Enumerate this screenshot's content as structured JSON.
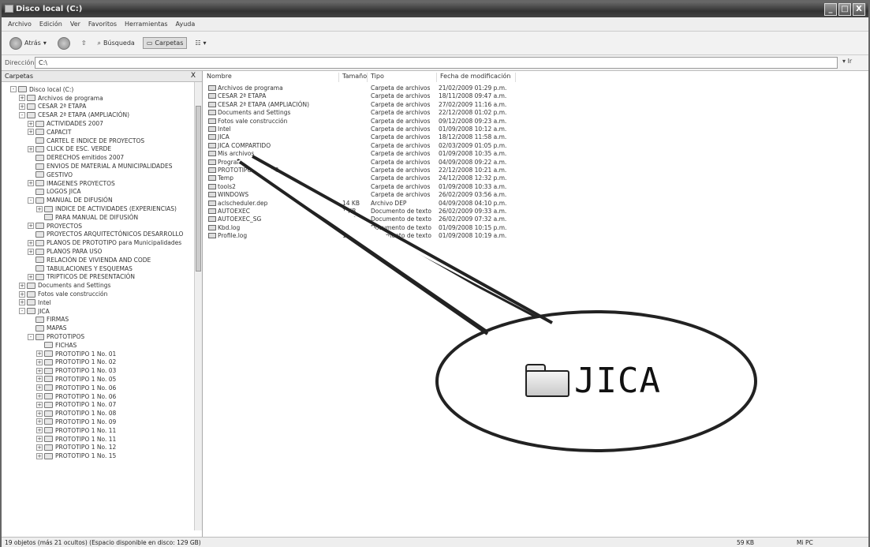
{
  "window": {
    "title": "Disco local (C:)"
  },
  "window_buttons": [
    "_",
    "□",
    "X"
  ],
  "menu": [
    "Archivo",
    "Edición",
    "Ver",
    "Favoritos",
    "Herramientas",
    "Ayuda"
  ],
  "toolbar": {
    "back": "Atrás",
    "search": "Búsqueda",
    "folders": "Carpetas"
  },
  "address": {
    "label": "Dirección",
    "value": "C:\\",
    "go": "Ir"
  },
  "left_pane": {
    "title": "Carpetas",
    "close": "X",
    "tree": [
      {
        "exp": "-",
        "label": "Disco local (C:)",
        "indent": 1
      },
      {
        "exp": "+",
        "label": "Archivos de programa",
        "indent": 2
      },
      {
        "exp": "+",
        "label": "CESAR 2ª ETAPA",
        "indent": 2
      },
      {
        "exp": "-",
        "label": "CESAR 2ª ETAPA (AMPLIACIÓN)",
        "indent": 2
      },
      {
        "exp": "+",
        "label": "ACTIVIDADES 2007",
        "indent": 3
      },
      {
        "exp": "+",
        "label": "CAPACIT",
        "indent": 3
      },
      {
        "exp": "",
        "label": "CARTEL E INDICE DE PROYECTOS",
        "indent": 3
      },
      {
        "exp": "+",
        "label": "CLICK DE ESC. VERDE",
        "indent": 3
      },
      {
        "exp": "",
        "label": "DERECHOS emitidos 2007",
        "indent": 3
      },
      {
        "exp": "",
        "label": "ENVIOS DE MATERIAL A MUNICIPALIDADES",
        "indent": 3
      },
      {
        "exp": "",
        "label": "GESTIVO",
        "indent": 3
      },
      {
        "exp": "+",
        "label": "IMAGENES PROYECTOS",
        "indent": 3
      },
      {
        "exp": "",
        "label": "LOGOS JICA",
        "indent": 3
      },
      {
        "exp": "-",
        "label": "MANUAL DE DIFUSIÓN",
        "indent": 3
      },
      {
        "exp": "+",
        "label": "INDICE DE ACTIVIDADES (EXPERIENCIAS)",
        "indent": 4
      },
      {
        "exp": "",
        "label": "PARA MANUAL DE DIFUSIÓN",
        "indent": 4
      },
      {
        "exp": "+",
        "label": "PROYECTOS",
        "indent": 3
      },
      {
        "exp": "",
        "label": "PROYECTOS ARQUITECTÓNICOS DESARROLLO",
        "indent": 3
      },
      {
        "exp": "+",
        "label": "PLANOS DE PROTOTIPO para Municipalidades",
        "indent": 3
      },
      {
        "exp": "+",
        "label": "PLANOS PARA USO",
        "indent": 3
      },
      {
        "exp": "",
        "label": "RELACIÓN DE VIVIENDA AND CODE",
        "indent": 3
      },
      {
        "exp": "",
        "label": "TABULACIONES Y ESQUEMAS",
        "indent": 3
      },
      {
        "exp": "+",
        "label": "TRIPTICOS DE PRESENTACIÓN",
        "indent": 3
      },
      {
        "exp": "+",
        "label": "Documents and Settings",
        "indent": 2
      },
      {
        "exp": "+",
        "label": "Fotos vale construcción",
        "indent": 2
      },
      {
        "exp": "+",
        "label": "Intel",
        "indent": 2
      },
      {
        "exp": "-",
        "label": "JICA",
        "indent": 2
      },
      {
        "exp": "",
        "label": "FIRMAS",
        "indent": 3
      },
      {
        "exp": "",
        "label": "MAPAS",
        "indent": 3
      },
      {
        "exp": "-",
        "label": "PROTOTIPOS",
        "indent": 3
      },
      {
        "exp": "",
        "label": "FICHAS",
        "indent": 4
      },
      {
        "exp": "+",
        "label": "PROTOTIPO 1 No. 01",
        "indent": 4
      },
      {
        "exp": "+",
        "label": "PROTOTIPO 1 No. 02",
        "indent": 4
      },
      {
        "exp": "+",
        "label": "PROTOTIPO 1 No. 03",
        "indent": 4
      },
      {
        "exp": "+",
        "label": "PROTOTIPO 1 No. 05",
        "indent": 4
      },
      {
        "exp": "+",
        "label": "PROTOTIPO 1 No. 06",
        "indent": 4
      },
      {
        "exp": "+",
        "label": "PROTOTIPO 1 No. 06",
        "indent": 4
      },
      {
        "exp": "+",
        "label": "PROTOTIPO 1 No. 07",
        "indent": 4
      },
      {
        "exp": "+",
        "label": "PROTOTIPO 1 No. 08",
        "indent": 4
      },
      {
        "exp": "+",
        "label": "PROTOTIPO 1 No. 09",
        "indent": 4
      },
      {
        "exp": "+",
        "label": "PROTOTIPO 1 No. 11",
        "indent": 4
      },
      {
        "exp": "+",
        "label": "PROTOTIPO 1 No. 11",
        "indent": 4
      },
      {
        "exp": "+",
        "label": "PROTOTIPO 1 No. 12",
        "indent": 4
      },
      {
        "exp": "+",
        "label": "PROTOTIPO 1 No. 15",
        "indent": 4
      }
    ]
  },
  "list": {
    "headers": {
      "name": "Nombre",
      "size": "Tamaño",
      "type": "Tipo",
      "date": "Fecha de modificación"
    },
    "rows": [
      {
        "name": "Archivos de programa",
        "size": "",
        "type": "Carpeta de archivos",
        "date": "21/02/2009 01:29 p.m."
      },
      {
        "name": "CESAR 2ª ETAPA",
        "size": "",
        "type": "Carpeta de archivos",
        "date": "18/11/2008 09:47 a.m."
      },
      {
        "name": "CESAR 2ª ETAPA (AMPLIACIÓN)",
        "size": "",
        "type": "Carpeta de archivos",
        "date": "27/02/2009 11:16 a.m."
      },
      {
        "name": "Documents and Settings",
        "size": "",
        "type": "Carpeta de archivos",
        "date": "22/12/2008 01:02 p.m."
      },
      {
        "name": "Fotos vale construcción",
        "size": "",
        "type": "Carpeta de archivos",
        "date": "09/12/2008 09:23 a.m."
      },
      {
        "name": "Intel",
        "size": "",
        "type": "Carpeta de archivos",
        "date": "01/09/2008 10:12 a.m."
      },
      {
        "name": "JICA",
        "size": "",
        "type": "Carpeta de archivos",
        "date": "18/12/2008 11:58 a.m."
      },
      {
        "name": "JICA COMPARTIDO",
        "size": "",
        "type": "Carpeta de archivos",
        "date": "02/03/2009 01:05 p.m."
      },
      {
        "name": "Mis archivos",
        "size": "",
        "type": "Carpeta de archivos",
        "date": "01/09/2008 10:35 a.m."
      },
      {
        "name": "Program Files",
        "size": "",
        "type": "Carpeta de archivos",
        "date": "04/09/2008 09:22 a.m."
      },
      {
        "name": "PROTOTIPO 1 No. 08",
        "size": "",
        "type": "Carpeta de archivos",
        "date": "22/12/2008 10:21 a.m."
      },
      {
        "name": "Temp",
        "size": "",
        "type": "Carpeta de archivos",
        "date": "24/12/2008 12:32 p.m."
      },
      {
        "name": "tools2",
        "size": "",
        "type": "Carpeta de archivos",
        "date": "01/09/2008 10:33 a.m."
      },
      {
        "name": "WINDOWS",
        "size": "",
        "type": "Carpeta de archivos",
        "date": "26/02/2009 03:56 a.m."
      },
      {
        "name": "aclscheduler.dep",
        "size": "14 KB",
        "type": "Archivo DEP",
        "date": "04/09/2008 04:10 p.m."
      },
      {
        "name": "AUTOEXEC",
        "size": "1 KB",
        "type": "Documento de texto",
        "date": "26/02/2009 09:33 a.m."
      },
      {
        "name": "AUTOEXEC_SG",
        "size": "1 KB",
        "type": "Documento de texto",
        "date": "26/02/2009 07:32 a.m."
      },
      {
        "name": "Kbd.log",
        "size": "1 KB",
        "type": "Documento de texto",
        "date": "01/09/2008 10:15 p.m."
      },
      {
        "name": "Profile.log",
        "size": "1 KB",
        "type": "Documento de texto",
        "date": "01/09/2008 10:19 a.m."
      }
    ]
  },
  "status": {
    "left": "19 objetos (más 21 ocultos) (Espacio disponible en disco: 129 GB)",
    "size": "59 KB",
    "zone": "Mi PC"
  },
  "callout": {
    "label": "JICA"
  }
}
